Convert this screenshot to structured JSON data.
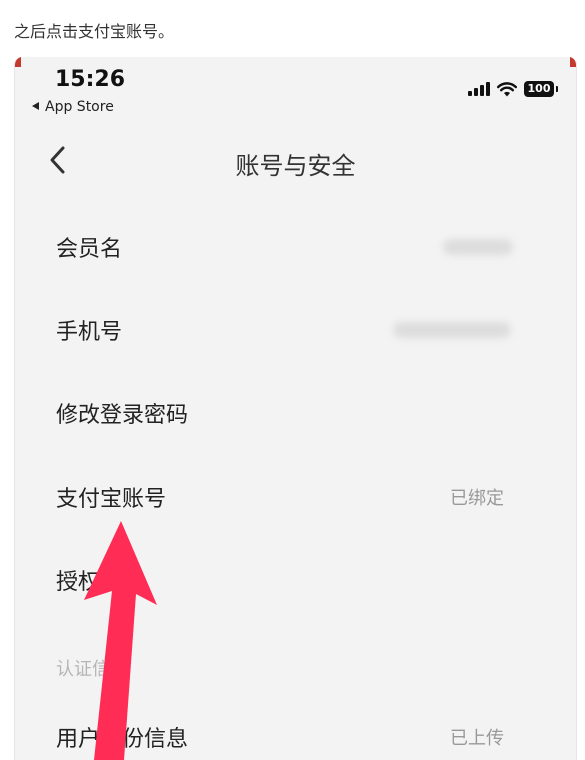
{
  "caption": "之后点击支付宝账号。",
  "status": {
    "time": "15:26",
    "back_label": "App Store",
    "battery": "100"
  },
  "nav": {
    "title": "账号与安全"
  },
  "rows": [
    {
      "label": "会员名",
      "value": ""
    },
    {
      "label": "手机号",
      "value": ""
    },
    {
      "label": "修改登录密码",
      "value": ""
    },
    {
      "label": "支付宝账号",
      "value": "已绑定"
    },
    {
      "label": "授权管理",
      "value": ""
    }
  ],
  "section_title": "认证信息",
  "identity_row": {
    "label": "用户身份信息",
    "value": "已上传"
  },
  "colors": {
    "arrow": "#ff2d55",
    "corner": "#c43a2f"
  }
}
